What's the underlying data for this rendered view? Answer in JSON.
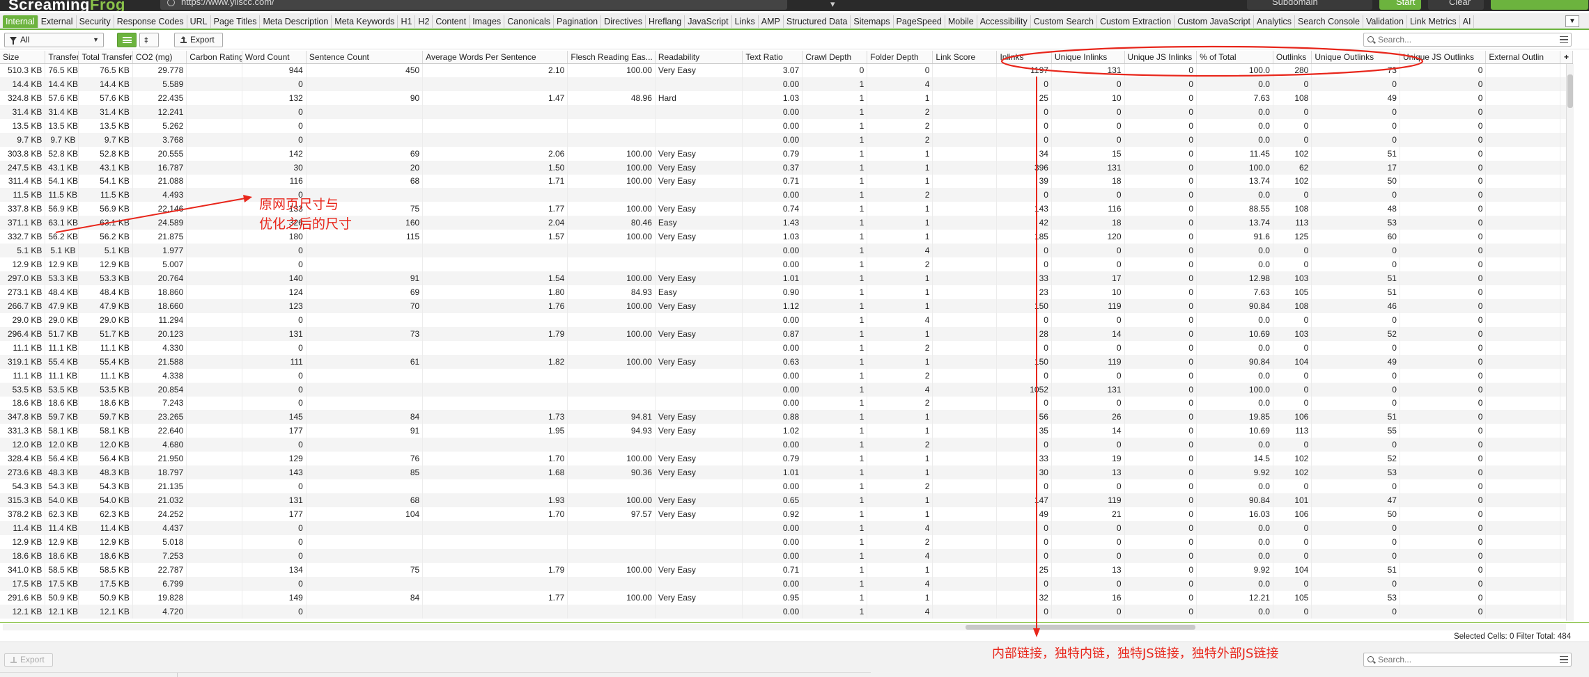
{
  "app": {
    "logo_text": "Screaming",
    "logo_text_2": "Frog",
    "url": "https://www.yiiscc.com/",
    "mode": "Subdomain",
    "start": "Start",
    "clear": "Clear",
    "accent_color": "#6cb33e"
  },
  "tabs": [
    "Internal",
    "External",
    "Security",
    "Response Codes",
    "URL",
    "Page Titles",
    "Meta Description",
    "Meta Keywords",
    "H1",
    "H2",
    "Content",
    "Images",
    "Canonicals",
    "Pagination",
    "Directives",
    "Hreflang",
    "JavaScript",
    "Links",
    "AMP",
    "Structured Data",
    "Sitemaps",
    "PageSpeed",
    "Mobile",
    "Accessibility",
    "Custom Search",
    "Custom Extraction",
    "Custom JavaScript",
    "Analytics",
    "Search Console",
    "Validation",
    "Link Metrics",
    "AI"
  ],
  "active_tab": "Internal",
  "toolbar": {
    "filter_value": "All",
    "export_label": "Export",
    "search_placeholder": "Search..."
  },
  "columns": [
    "Size",
    "Transferred",
    "Total Transferred",
    "CO2 (mg)",
    "Carbon Rating",
    "Word Count",
    "Sentence Count",
    "Average Words Per Sentence",
    "Flesch Reading Eas...",
    "Readability",
    "Text Ratio",
    "Crawl Depth",
    "Folder Depth",
    "Link Score",
    "Inlinks",
    "Unique Inlinks",
    "Unique JS Inlinks",
    "% of Total",
    "Outlinks",
    "Unique Outlinks",
    "Unique JS Outlinks",
    "External Outlin"
  ],
  "rows": [
    [
      "510.3 KB",
      "76.5 KB",
      "76.5 KB",
      "29.778",
      "",
      "944",
      "450",
      "2.10",
      "100.00",
      "Very Easy",
      "3.07",
      "0",
      "0",
      "",
      "1197",
      "131",
      "0",
      "100.0",
      "280",
      "73",
      "0",
      ""
    ],
    [
      "14.4 KB",
      "14.4 KB",
      "14.4 KB",
      "5.589",
      "",
      "0",
      "",
      "",
      "",
      "",
      "0.00",
      "1",
      "4",
      "",
      "0",
      "0",
      "0",
      "0.0",
      "0",
      "0",
      "0",
      ""
    ],
    [
      "324.8 KB",
      "57.6 KB",
      "57.6 KB",
      "22.435",
      "",
      "132",
      "90",
      "1.47",
      "48.96",
      "Hard",
      "1.03",
      "1",
      "1",
      "",
      "25",
      "10",
      "0",
      "7.63",
      "108",
      "49",
      "0",
      ""
    ],
    [
      "31.4 KB",
      "31.4 KB",
      "31.4 KB",
      "12.241",
      "",
      "0",
      "",
      "",
      "",
      "",
      "0.00",
      "1",
      "2",
      "",
      "0",
      "0",
      "0",
      "0.0",
      "0",
      "0",
      "0",
      ""
    ],
    [
      "13.5 KB",
      "13.5 KB",
      "13.5 KB",
      "5.262",
      "",
      "0",
      "",
      "",
      "",
      "",
      "0.00",
      "1",
      "2",
      "",
      "0",
      "0",
      "0",
      "0.0",
      "0",
      "0",
      "0",
      ""
    ],
    [
      "9.7 KB",
      "9.7 KB",
      "9.7 KB",
      "3.768",
      "",
      "0",
      "",
      "",
      "",
      "",
      "0.00",
      "1",
      "2",
      "",
      "0",
      "0",
      "0",
      "0.0",
      "0",
      "0",
      "0",
      ""
    ],
    [
      "303.8 KB",
      "52.8 KB",
      "52.8 KB",
      "20.555",
      "",
      "142",
      "69",
      "2.06",
      "100.00",
      "Very Easy",
      "0.79",
      "1",
      "1",
      "",
      "34",
      "15",
      "0",
      "11.45",
      "102",
      "51",
      "0",
      ""
    ],
    [
      "247.5 KB",
      "43.1 KB",
      "43.1 KB",
      "16.787",
      "",
      "30",
      "20",
      "1.50",
      "100.00",
      "Very Easy",
      "0.37",
      "1",
      "1",
      "",
      "396",
      "131",
      "0",
      "100.0",
      "62",
      "17",
      "0",
      ""
    ],
    [
      "311.4 KB",
      "54.1 KB",
      "54.1 KB",
      "21.088",
      "",
      "116",
      "68",
      "1.71",
      "100.00",
      "Very Easy",
      "0.71",
      "1",
      "1",
      "",
      "39",
      "18",
      "0",
      "13.74",
      "102",
      "50",
      "0",
      ""
    ],
    [
      "11.5 KB",
      "11.5 KB",
      "11.5 KB",
      "4.493",
      "",
      "0",
      "",
      "",
      "",
      "",
      "0.00",
      "1",
      "2",
      "",
      "0",
      "0",
      "0",
      "0.0",
      "0",
      "0",
      "0",
      ""
    ],
    [
      "337.8 KB",
      "56.9 KB",
      "56.9 KB",
      "22.146",
      "",
      "133",
      "75",
      "1.77",
      "100.00",
      "Very Easy",
      "0.74",
      "1",
      "1",
      "",
      "143",
      "116",
      "0",
      "88.55",
      "108",
      "48",
      "0",
      ""
    ],
    [
      "371.1 KB",
      "63.1 KB",
      "63.1 KB",
      "24.589",
      "",
      "326",
      "160",
      "2.04",
      "80.46",
      "Easy",
      "1.43",
      "1",
      "1",
      "",
      "42",
      "18",
      "0",
      "13.74",
      "113",
      "53",
      "0",
      ""
    ],
    [
      "332.7 KB",
      "56.2 KB",
      "56.2 KB",
      "21.875",
      "",
      "180",
      "115",
      "1.57",
      "100.00",
      "Very Easy",
      "1.03",
      "1",
      "1",
      "",
      "185",
      "120",
      "0",
      "91.6",
      "125",
      "60",
      "0",
      ""
    ],
    [
      "5.1 KB",
      "5.1 KB",
      "5.1 KB",
      "1.977",
      "",
      "0",
      "",
      "",
      "",
      "",
      "0.00",
      "1",
      "4",
      "",
      "0",
      "0",
      "0",
      "0.0",
      "0",
      "0",
      "0",
      ""
    ],
    [
      "12.9 KB",
      "12.9 KB",
      "12.9 KB",
      "5.007",
      "",
      "0",
      "",
      "",
      "",
      "",
      "0.00",
      "1",
      "2",
      "",
      "0",
      "0",
      "0",
      "0.0",
      "0",
      "0",
      "0",
      ""
    ],
    [
      "297.0 KB",
      "53.3 KB",
      "53.3 KB",
      "20.764",
      "",
      "140",
      "91",
      "1.54",
      "100.00",
      "Very Easy",
      "1.01",
      "1",
      "1",
      "",
      "33",
      "17",
      "0",
      "12.98",
      "103",
      "51",
      "0",
      ""
    ],
    [
      "273.1 KB",
      "48.4 KB",
      "48.4 KB",
      "18.860",
      "",
      "124",
      "69",
      "1.80",
      "84.93",
      "Easy",
      "0.90",
      "1",
      "1",
      "",
      "23",
      "10",
      "0",
      "7.63",
      "105",
      "51",
      "0",
      ""
    ],
    [
      "266.7 KB",
      "47.9 KB",
      "47.9 KB",
      "18.660",
      "",
      "123",
      "70",
      "1.76",
      "100.00",
      "Very Easy",
      "1.12",
      "1",
      "1",
      "",
      "150",
      "119",
      "0",
      "90.84",
      "108",
      "46",
      "0",
      ""
    ],
    [
      "29.0 KB",
      "29.0 KB",
      "29.0 KB",
      "11.294",
      "",
      "0",
      "",
      "",
      "",
      "",
      "0.00",
      "1",
      "4",
      "",
      "0",
      "0",
      "0",
      "0.0",
      "0",
      "0",
      "0",
      ""
    ],
    [
      "296.4 KB",
      "51.7 KB",
      "51.7 KB",
      "20.123",
      "",
      "131",
      "73",
      "1.79",
      "100.00",
      "Very Easy",
      "0.87",
      "1",
      "1",
      "",
      "28",
      "14",
      "0",
      "10.69",
      "103",
      "52",
      "0",
      ""
    ],
    [
      "11.1 KB",
      "11.1 KB",
      "11.1 KB",
      "4.330",
      "",
      "0",
      "",
      "",
      "",
      "",
      "0.00",
      "1",
      "2",
      "",
      "0",
      "0",
      "0",
      "0.0",
      "0",
      "0",
      "0",
      ""
    ],
    [
      "319.1 KB",
      "55.4 KB",
      "55.4 KB",
      "21.588",
      "",
      "111",
      "61",
      "1.82",
      "100.00",
      "Very Easy",
      "0.63",
      "1",
      "1",
      "",
      "150",
      "119",
      "0",
      "90.84",
      "104",
      "49",
      "0",
      ""
    ],
    [
      "11.1 KB",
      "11.1 KB",
      "11.1 KB",
      "4.338",
      "",
      "0",
      "",
      "",
      "",
      "",
      "0.00",
      "1",
      "2",
      "",
      "0",
      "0",
      "0",
      "0.0",
      "0",
      "0",
      "0",
      ""
    ],
    [
      "53.5 KB",
      "53.5 KB",
      "53.5 KB",
      "20.854",
      "",
      "0",
      "",
      "",
      "",
      "",
      "0.00",
      "1",
      "4",
      "",
      "1052",
      "131",
      "0",
      "100.0",
      "0",
      "0",
      "0",
      ""
    ],
    [
      "18.6 KB",
      "18.6 KB",
      "18.6 KB",
      "7.243",
      "",
      "0",
      "",
      "",
      "",
      "",
      "0.00",
      "1",
      "2",
      "",
      "0",
      "0",
      "0",
      "0.0",
      "0",
      "0",
      "0",
      ""
    ],
    [
      "347.8 KB",
      "59.7 KB",
      "59.7 KB",
      "23.265",
      "",
      "145",
      "84",
      "1.73",
      "94.81",
      "Very Easy",
      "0.88",
      "1",
      "1",
      "",
      "56",
      "26",
      "0",
      "19.85",
      "106",
      "51",
      "0",
      ""
    ],
    [
      "331.3 KB",
      "58.1 KB",
      "58.1 KB",
      "22.640",
      "",
      "177",
      "91",
      "1.95",
      "94.93",
      "Very Easy",
      "1.02",
      "1",
      "1",
      "",
      "35",
      "14",
      "0",
      "10.69",
      "113",
      "55",
      "0",
      ""
    ],
    [
      "12.0 KB",
      "12.0 KB",
      "12.0 KB",
      "4.680",
      "",
      "0",
      "",
      "",
      "",
      "",
      "0.00",
      "1",
      "2",
      "",
      "0",
      "0",
      "0",
      "0.0",
      "0",
      "0",
      "0",
      ""
    ],
    [
      "328.4 KB",
      "56.4 KB",
      "56.4 KB",
      "21.950",
      "",
      "129",
      "76",
      "1.70",
      "100.00",
      "Very Easy",
      "0.79",
      "1",
      "1",
      "",
      "33",
      "19",
      "0",
      "14.5",
      "102",
      "52",
      "0",
      ""
    ],
    [
      "273.6 KB",
      "48.3 KB",
      "48.3 KB",
      "18.797",
      "",
      "143",
      "85",
      "1.68",
      "90.36",
      "Very Easy",
      "1.01",
      "1",
      "1",
      "",
      "30",
      "13",
      "0",
      "9.92",
      "102",
      "53",
      "0",
      ""
    ],
    [
      "54.3 KB",
      "54.3 KB",
      "54.3 KB",
      "21.135",
      "",
      "0",
      "",
      "",
      "",
      "",
      "0.00",
      "1",
      "2",
      "",
      "0",
      "0",
      "0",
      "0.0",
      "0",
      "0",
      "0",
      ""
    ],
    [
      "315.3 KB",
      "54.0 KB",
      "54.0 KB",
      "21.032",
      "",
      "131",
      "68",
      "1.93",
      "100.00",
      "Very Easy",
      "0.65",
      "1",
      "1",
      "",
      "147",
      "119",
      "0",
      "90.84",
      "101",
      "47",
      "0",
      ""
    ],
    [
      "378.2 KB",
      "62.3 KB",
      "62.3 KB",
      "24.252",
      "",
      "177",
      "104",
      "1.70",
      "97.57",
      "Very Easy",
      "0.92",
      "1",
      "1",
      "",
      "49",
      "21",
      "0",
      "16.03",
      "106",
      "50",
      "0",
      ""
    ],
    [
      "11.4 KB",
      "11.4 KB",
      "11.4 KB",
      "4.437",
      "",
      "0",
      "",
      "",
      "",
      "",
      "0.00",
      "1",
      "4",
      "",
      "0",
      "0",
      "0",
      "0.0",
      "0",
      "0",
      "0",
      ""
    ],
    [
      "12.9 KB",
      "12.9 KB",
      "12.9 KB",
      "5.018",
      "",
      "0",
      "",
      "",
      "",
      "",
      "0.00",
      "1",
      "2",
      "",
      "0",
      "0",
      "0",
      "0.0",
      "0",
      "0",
      "0",
      ""
    ],
    [
      "18.6 KB",
      "18.6 KB",
      "18.6 KB",
      "7.253",
      "",
      "0",
      "",
      "",
      "",
      "",
      "0.00",
      "1",
      "4",
      "",
      "0",
      "0",
      "0",
      "0.0",
      "0",
      "0",
      "0",
      ""
    ],
    [
      "341.0 KB",
      "58.5 KB",
      "58.5 KB",
      "22.787",
      "",
      "134",
      "75",
      "1.79",
      "100.00",
      "Very Easy",
      "0.71",
      "1",
      "1",
      "",
      "25",
      "13",
      "0",
      "9.92",
      "104",
      "51",
      "0",
      ""
    ],
    [
      "17.5 KB",
      "17.5 KB",
      "17.5 KB",
      "6.799",
      "",
      "0",
      "",
      "",
      "",
      "",
      "0.00",
      "1",
      "4",
      "",
      "0",
      "0",
      "0",
      "0.0",
      "0",
      "0",
      "0",
      ""
    ],
    [
      "291.6 KB",
      "50.9 KB",
      "50.9 KB",
      "19.828",
      "",
      "149",
      "84",
      "1.77",
      "100.00",
      "Very Easy",
      "0.95",
      "1",
      "1",
      "",
      "32",
      "16",
      "0",
      "12.21",
      "105",
      "53",
      "0",
      ""
    ],
    [
      "12.1 KB",
      "12.1 KB",
      "12.1 KB",
      "4.720",
      "",
      "0",
      "",
      "",
      "",
      "",
      "0.00",
      "1",
      "4",
      "",
      "0",
      "0",
      "0",
      "0.0",
      "0",
      "0",
      "0",
      ""
    ]
  ],
  "status": {
    "selected_cells_label": "Selected Cells:",
    "selected_cells": "0",
    "filter_total_label": "Filter Total:",
    "filter_total": "484"
  },
  "bottom": {
    "export_label": "Export",
    "search_placeholder": "Search..."
  },
  "annotations": {
    "size_note_line1": "原网页尺寸与",
    "size_note_line2": "优化之后的尺寸",
    "links_note": "内部链接，独特内链，独特JS链接，独特外部JS链接",
    "color": "#e8261b"
  }
}
